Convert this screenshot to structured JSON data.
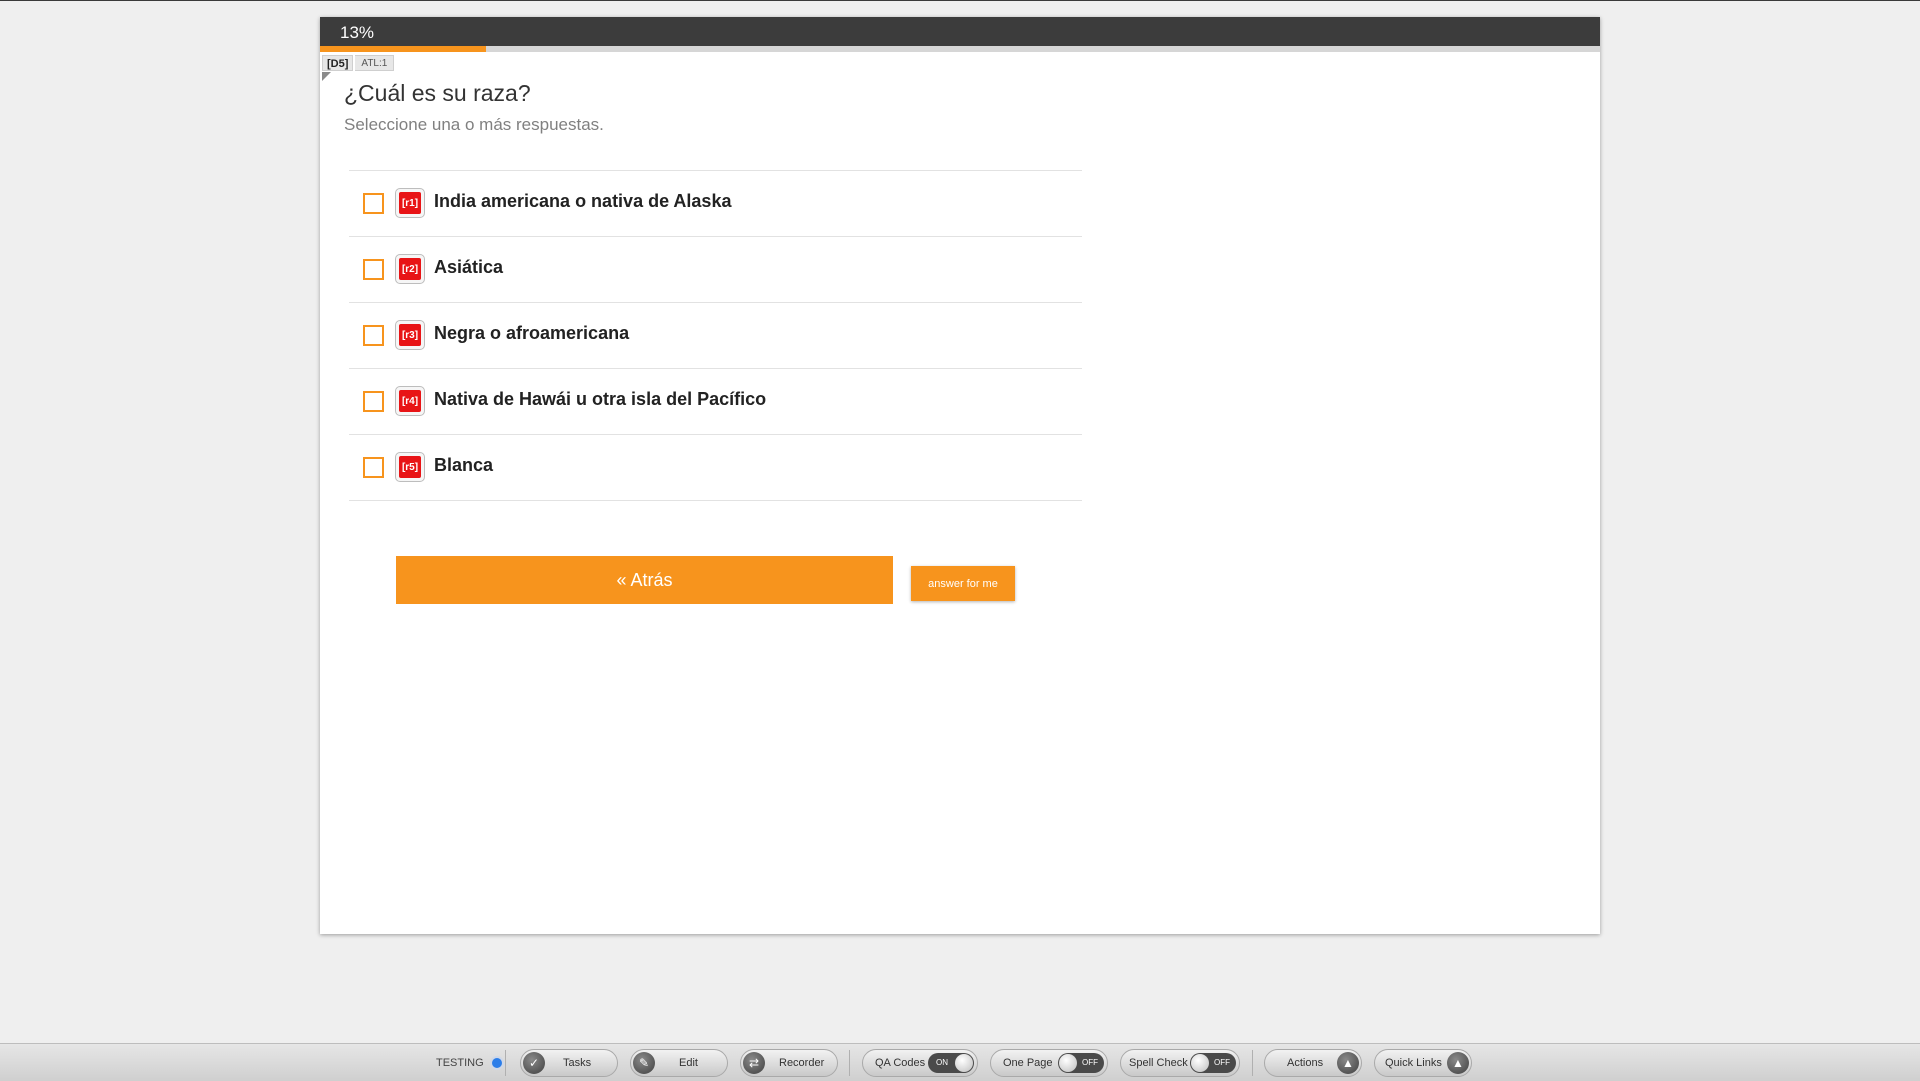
{
  "progress": {
    "label": "13%",
    "fraction": 0.13,
    "color": "#f7941d"
  },
  "question": {
    "tag": "[D5]",
    "atl": "ATL:1",
    "title": "¿Cuál es su raza?",
    "instruction": "Seleccione una o más respuestas."
  },
  "options": [
    {
      "code": "[r1]",
      "label": "India americana o nativa de Alaska"
    },
    {
      "code": "[r2]",
      "label": "Asiática"
    },
    {
      "code": "[r3]",
      "label": "Negra o afroamericana"
    },
    {
      "code": "[r4]",
      "label": "Nativa de Hawái u otra isla del Pacífico"
    },
    {
      "code": "[r5]",
      "label": "Blanca"
    }
  ],
  "buttons": {
    "back": "« Atrás",
    "answer_for_me": "answer for me"
  },
  "toolbar": {
    "testing": "TESTING",
    "tasks": "Tasks",
    "edit": "Edit",
    "recorder": "Recorder",
    "qa_codes": {
      "label": "QA Codes",
      "state": "ON"
    },
    "one_page": {
      "label": "One Page",
      "state": "OFF"
    },
    "spell_check": {
      "label": "Spell Check",
      "state": "OFF"
    },
    "actions": "Actions",
    "quick_links": "Quick Links"
  },
  "icons": {
    "tasks": "checkmark-icon",
    "edit": "edit-icon",
    "recorder": "recorder-icon",
    "actions": "up-triangle-icon",
    "quick_links": "up-triangle-icon"
  }
}
